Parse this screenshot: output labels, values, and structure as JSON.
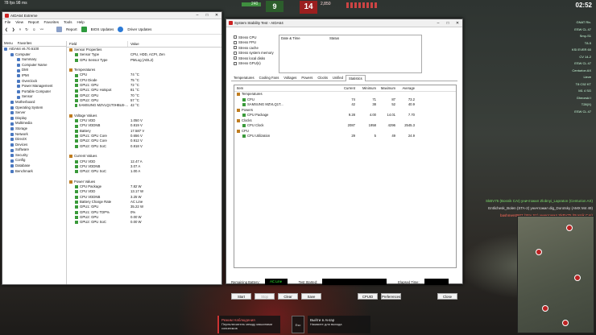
{
  "game": {
    "top_left": "78 fps  98 ms",
    "score_ally_label": "240",
    "score_ally": "9",
    "score_enemy": "14",
    "score_enemy_label": "2,850",
    "clock": "02:52",
    "players": [
      "GNAT Riv.",
      "ESW CL 47",
      "Smy-S1",
      "T8-5",
      "KSI EVER 60",
      "CV 14-2",
      "ESW CL 47",
      "Centurion AX",
      "Lieve",
      "T8 C52 KT",
      "M1 4 SG",
      "Gheorski I",
      "T28(X)",
      "ESW CL 47"
    ],
    "killfeed": [
      "SkBV75 (Bosnik CAI) уничтожил Zlobnyi_Lapraton (Centurion AX)",
      "Entlichesk_Bolen (STA-2) уничтожил dig_Dorotsky (AMX M4 49)",
      "bashmen0907 (Strv S1) уничтожил SkBV75 (Bosnik CAI)"
    ],
    "bottom_left_title": "Режим Наблюдения",
    "bottom_left_sub": "Переключатель между машинами союзников",
    "bottom_esc": "Esc",
    "bottom_right_title": "Выйти в Ангар",
    "bottom_right_sub": "Нажмите для выхода"
  },
  "aida": {
    "title": "AIDA64 Extreme",
    "menu": [
      "File",
      "View",
      "Report",
      "Favorites",
      "Tools",
      "Help"
    ],
    "toolbar": {
      "report": "Report",
      "bios": "BIOS Updates",
      "drivers": "Driver Updates"
    },
    "tree_tabs": [
      "Menu",
      "Favorites"
    ],
    "tree": [
      {
        "label": "AIDA64 v6.70.6100",
        "indent": 0
      },
      {
        "label": "Computer",
        "indent": 1
      },
      {
        "label": "Summary",
        "indent": 2
      },
      {
        "label": "Computer Name",
        "indent": 2
      },
      {
        "label": "DMI",
        "indent": 2
      },
      {
        "label": "IPMI",
        "indent": 2
      },
      {
        "label": "Overclock",
        "indent": 2
      },
      {
        "label": "Power Management",
        "indent": 2
      },
      {
        "label": "Portable Computer",
        "indent": 2
      },
      {
        "label": "Sensor",
        "indent": 2
      },
      {
        "label": "Motherboard",
        "indent": 1
      },
      {
        "label": "Operating System",
        "indent": 1
      },
      {
        "label": "Server",
        "indent": 1
      },
      {
        "label": "Display",
        "indent": 1
      },
      {
        "label": "Multimedia",
        "indent": 1
      },
      {
        "label": "Storage",
        "indent": 1
      },
      {
        "label": "Network",
        "indent": 1
      },
      {
        "label": "DirectX",
        "indent": 1
      },
      {
        "label": "Devices",
        "indent": 1
      },
      {
        "label": "Software",
        "indent": 1
      },
      {
        "label": "Security",
        "indent": 1
      },
      {
        "label": "Config",
        "indent": 1
      },
      {
        "label": "Database",
        "indent": 1
      },
      {
        "label": "Benchmark",
        "indent": 1
      }
    ],
    "detail_headers": {
      "field": "Field",
      "value": "Value"
    },
    "sections": [
      {
        "title": "Sensor Properties",
        "rows": [
          [
            "Sensor Type",
            "CPU, HDD, ACPI, Zen"
          ],
          [
            "GPU Sensor Type",
            "PMLog (ADL2)"
          ]
        ]
      },
      {
        "title": "Temperatures",
        "rows": [
          [
            "CPU",
            "74 °C"
          ],
          [
            "CPU Diode",
            "75 °C"
          ],
          [
            "GPU1: GPU",
            "72 °C"
          ],
          [
            "GPU1: GPU Hotspot",
            "81 °C"
          ],
          [
            "GPU2: GPU",
            "70 °C"
          ],
          [
            "GPU2: GPU",
            "57 °C"
          ],
          [
            "SAMSUNG MZVLQ1T0HBLB-...",
            "42 °C"
          ]
        ]
      },
      {
        "title": "Voltage Values",
        "rows": [
          [
            "CPU VDD",
            "1.050 V"
          ],
          [
            "CPU VDDNB",
            "0.819 V"
          ],
          [
            "Battery",
            "17.587 V"
          ],
          [
            "GPU1: GPU Core",
            "0.656 V"
          ],
          [
            "GPU2: GPU Core",
            "0.912 V"
          ],
          [
            "GPU2: GPU SoC",
            "0.818 V"
          ]
        ]
      },
      {
        "title": "Current Values",
        "rows": [
          [
            "CPU VDD",
            "12.47 A"
          ],
          [
            "CPU VDDNB",
            "3.07 A"
          ],
          [
            "GPU2: GPU SoC",
            "1.00 A"
          ]
        ]
      },
      {
        "title": "Power Values",
        "rows": [
          [
            "CPU Package",
            "7.82 W"
          ],
          [
            "CPU VDD",
            "13.17 W"
          ],
          [
            "CPU VDDNB",
            "3.25 W"
          ],
          [
            "Battery Charge Rate",
            "AC Line"
          ],
          [
            "GPU1: GPU",
            "35.22 W"
          ],
          [
            "GPU1: GPU TDP%",
            "0%"
          ],
          [
            "GPU2: GPU",
            "0.00 W"
          ],
          [
            "GPU2: GPU SoC",
            "0.00 W"
          ]
        ]
      }
    ]
  },
  "stability": {
    "title": "System Stability Test - AIDA64",
    "checks": [
      "Stress CPU",
      "Stress FPU",
      "Stress cache",
      "Stress system memory",
      "Stress local disks",
      "Stress GPU(s)"
    ],
    "log_headers": {
      "date": "Date & Time",
      "status": "Status"
    },
    "tabs": [
      "Temperatures",
      "Cooling Fans",
      "Voltages",
      "Powers",
      "Clocks",
      "Unified",
      "Statistics"
    ],
    "active_tab": "Statistics",
    "stat_headers": {
      "item": "Item",
      "current": "Current",
      "min": "Minimum",
      "max": "Maximum",
      "avg": "Average"
    },
    "stats": [
      {
        "type": "group",
        "label": "Temperatures"
      },
      {
        "type": "row",
        "label": "CPU",
        "cur": "74",
        "min": "71",
        "max": "87",
        "avg": "73.2"
      },
      {
        "type": "row",
        "label": "SAMSUNG MZVLQ1T...",
        "cur": "42",
        "min": "38",
        "max": "52",
        "avg": "40.9"
      },
      {
        "type": "group",
        "label": "Powers"
      },
      {
        "type": "row",
        "label": "CPU Package",
        "cur": "9.28",
        "min": "4.00",
        "max": "14.01",
        "avg": "7.70"
      },
      {
        "type": "group",
        "label": "Clocks"
      },
      {
        "type": "row",
        "label": "CPU Clock",
        "cur": "2087",
        "min": "1958",
        "max": "4296",
        "avg": "2545.3"
      },
      {
        "type": "group",
        "label": "CPU"
      },
      {
        "type": "row",
        "label": "CPU Utilization",
        "cur": "29",
        "min": "5",
        "max": "49",
        "avg": "24.9"
      }
    ],
    "status": {
      "battery_label": "Remaining Battery:",
      "battery_value": "AC Line",
      "started_label": "Test Started:",
      "elapsed_label": "Elapsed Time:"
    },
    "buttons": {
      "start": "Start",
      "stop": "Stop",
      "clear": "Clear",
      "save": "Save",
      "cpuid": "CPUID",
      "prefs": "Preferences",
      "close": "Close"
    }
  }
}
